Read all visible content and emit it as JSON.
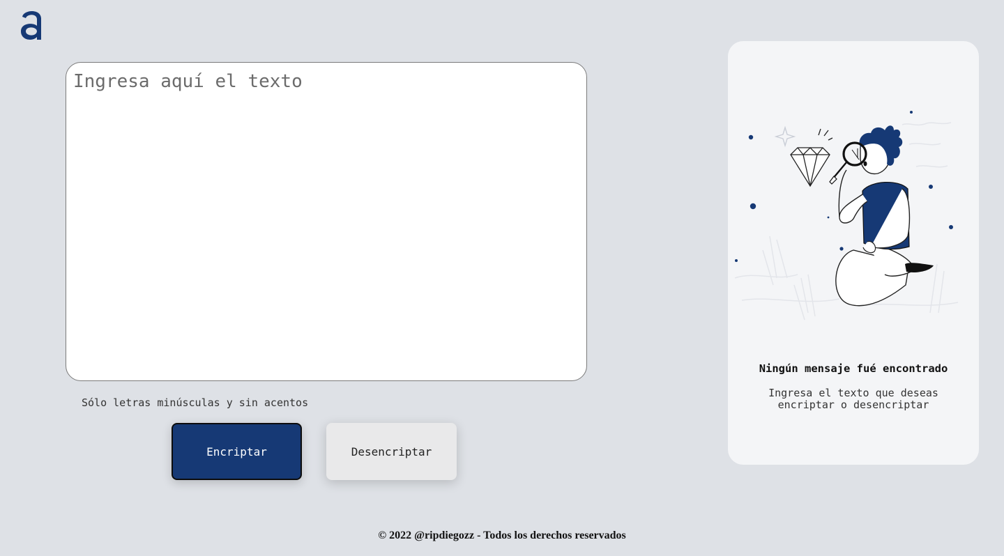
{
  "logo": {
    "icon": "alura-a-logo-icon",
    "color": "#163975"
  },
  "input": {
    "placeholder": "Ingresa aquí el texto",
    "value": ""
  },
  "hint": {
    "text": "Sólo letras minúsculas y sin acentos",
    "icon": "info-icon"
  },
  "buttons": {
    "encrypt_label": "Encriptar",
    "decrypt_label": "Desencriptar"
  },
  "result_panel": {
    "illustration": "person-with-magnifying-glass-illustration",
    "title": "Ningún mensaje fué encontrado",
    "text": "Ingresa el texto que deseas encriptar o desencriptar"
  },
  "footer": {
    "text": "© 2022 @ripdiegozz - Todos los derechos reservados"
  },
  "colors": {
    "background": "#dee1e6",
    "accent": "#163975",
    "card": "#f4f5f7"
  }
}
